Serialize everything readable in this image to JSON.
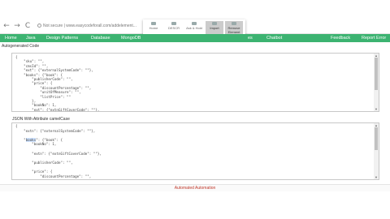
{
  "browser": {
    "back": "←",
    "forward": "→",
    "reload": "C",
    "address": "Not secure | www.easycodeforall.com/addelement..."
  },
  "popup": {
    "items": [
      "Home",
      "DESCR",
      "Ask & Hold",
      "Import",
      "Remove Element"
    ]
  },
  "menu": {
    "items": [
      "Home",
      "Java",
      "Design Patterns",
      "Database",
      "MongoDB",
      "Chatbot",
      "Feedback",
      "Report Error"
    ],
    "hidden_suffix": "es"
  },
  "section1_title": "Autogenerated Code",
  "section2_title": "JSON With Attribute camelCase",
  "code1": [
    "{",
    "    \"sku\": \"\",",
    "    \"cmsId\": \"\",",
    "    \"ext\": {\"externalSystemCode\": \"\"},",
    "    \"books\": {\"book\": {",
    "        \"publisherCode\": \"\",",
    "        \"price\": {",
    "            \"discountPercentage\": \"\",",
    "            \"unitOfMeasure\": \"\",",
    "            \"listPrice\": \"\"",
    "        },",
    "        \"bookNo\": 1,",
    "        \"ext\": {\"extnGiftCoverCode\": \"\"},"
  ],
  "code2": [
    "{",
    "    \"extn\": {\"externalSystemCode\": \"\"},",
    "",
    "    \"books\": {\"book\": {",
    "        \"bookNo\": 1,",
    "",
    "        \"extn\": {\"extnGiftCoverCode\": \"\"},",
    "",
    "        \"publisherCode\": \"\",",
    "",
    "        \"price\": {",
    "            \"discountPercentage\": \"\","
  ],
  "code2_highlight": "books",
  "footer_text": "Automated Automation",
  "colors": {
    "menu_bg": "#3cb371",
    "footer_text": "#c0392b"
  }
}
